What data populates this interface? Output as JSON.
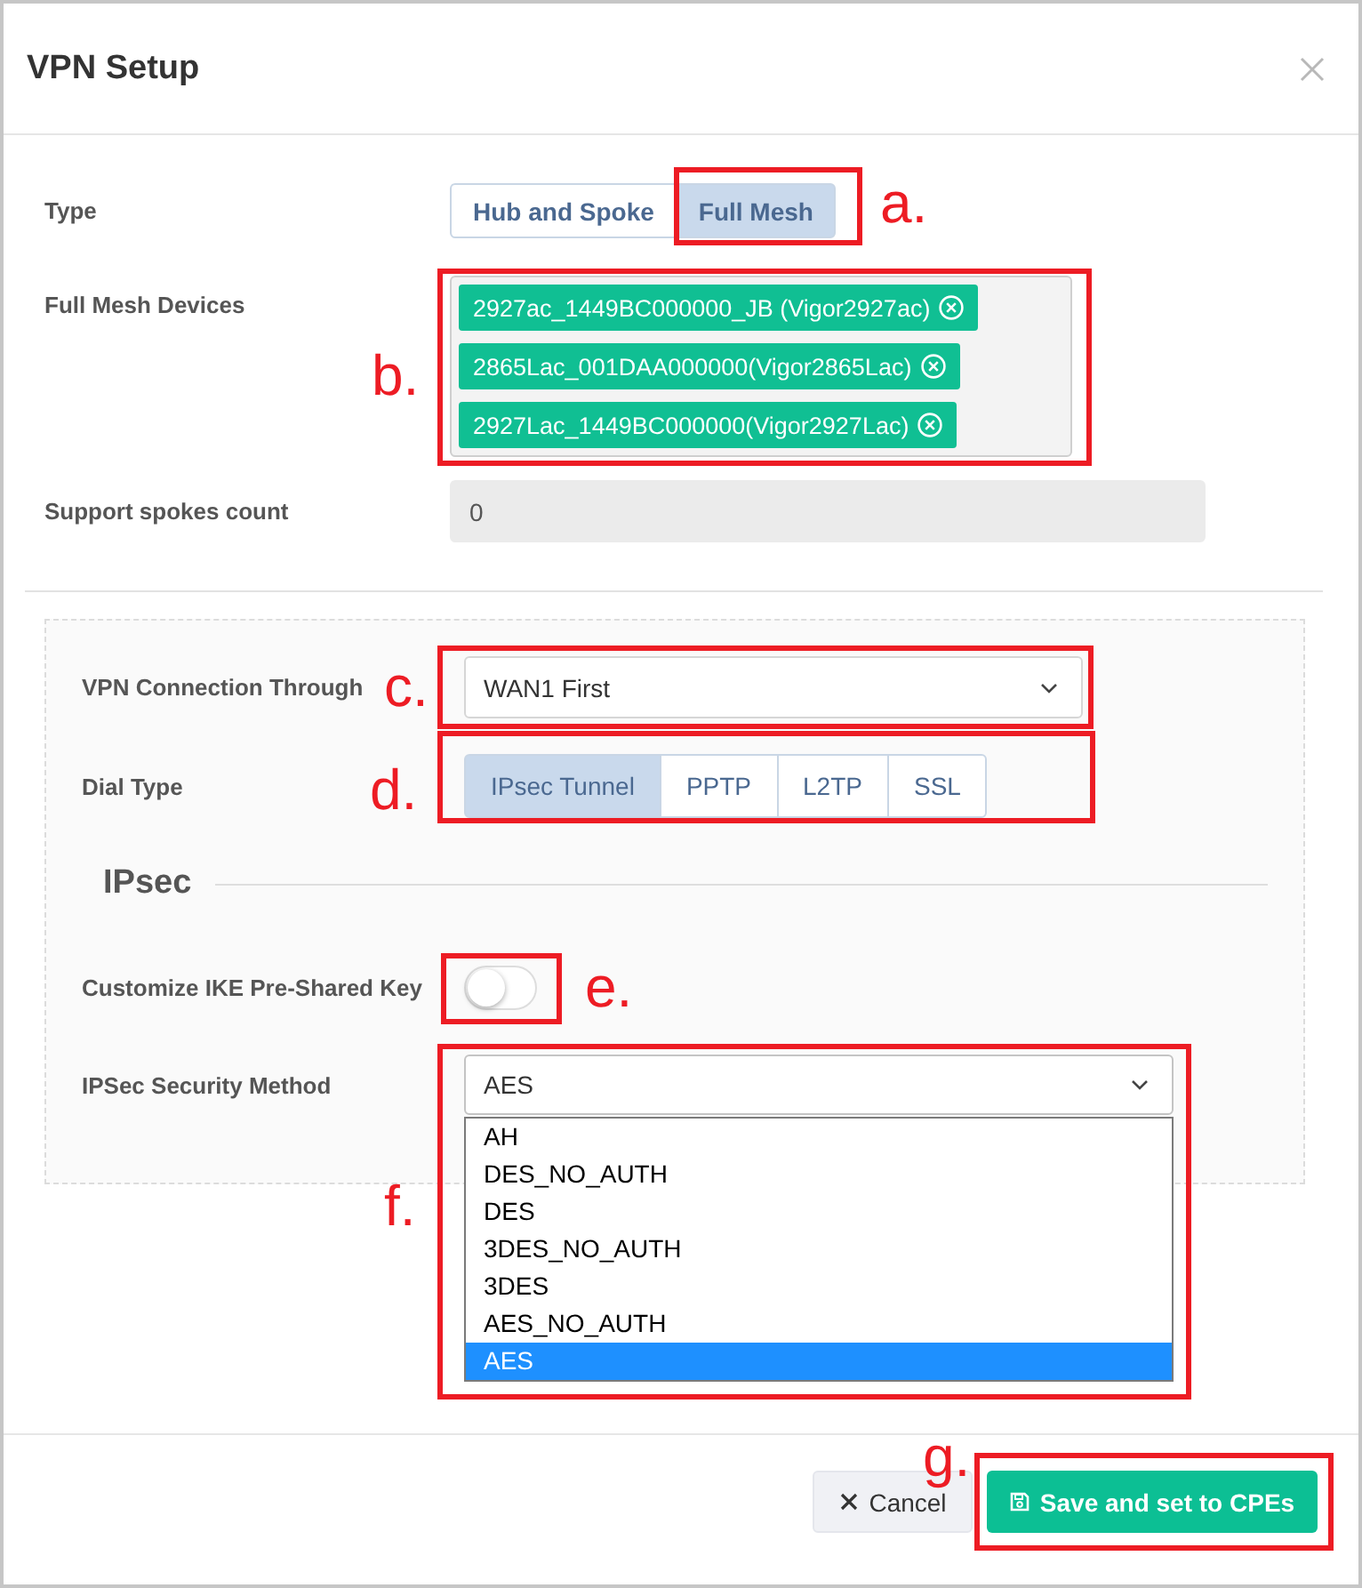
{
  "dialog": {
    "title": "VPN Setup"
  },
  "form": {
    "type": {
      "label": "Type",
      "options": [
        {
          "label": "Hub and Spoke",
          "selected": false
        },
        {
          "label": "Full Mesh",
          "selected": true
        }
      ]
    },
    "devices": {
      "label": "Full Mesh Devices",
      "tags": [
        "2927ac_1449BC000000_JB (Vigor2927ac)",
        "2865Lac_001DAA000000(Vigor2865Lac)",
        "2927Lac_1449BC000000(Vigor2927Lac)"
      ]
    },
    "spokes": {
      "label": "Support spokes count",
      "value": "0",
      "disabled": true
    }
  },
  "panel": {
    "connection": {
      "label": "VPN Connection Through",
      "value": "WAN1 First"
    },
    "dial_type": {
      "label": "Dial Type",
      "options": [
        {
          "label": "IPsec Tunnel",
          "selected": true
        },
        {
          "label": "PPTP",
          "selected": false
        },
        {
          "label": "L2TP",
          "selected": false
        },
        {
          "label": "SSL",
          "selected": false
        }
      ]
    },
    "section_title": "IPsec",
    "psk": {
      "label": "Customize IKE Pre-Shared Key",
      "on": false
    },
    "method": {
      "label": "IPSec Security Method",
      "value": "AES",
      "expanded": true,
      "options": [
        {
          "label": "AH",
          "selected": false
        },
        {
          "label": "DES_NO_AUTH",
          "selected": false
        },
        {
          "label": "DES",
          "selected": false
        },
        {
          "label": "3DES_NO_AUTH",
          "selected": false
        },
        {
          "label": "3DES",
          "selected": false
        },
        {
          "label": "AES_NO_AUTH",
          "selected": false
        },
        {
          "label": "AES",
          "selected": true
        }
      ]
    }
  },
  "footer": {
    "buttons": [
      {
        "kind": "cancel",
        "label": "Cancel"
      },
      {
        "kind": "save",
        "label": "Save and set to CPEs"
      }
    ]
  },
  "annotations": [
    {
      "label": "a."
    },
    {
      "label": "b."
    },
    {
      "label": "c."
    },
    {
      "label": "d."
    },
    {
      "label": "e."
    },
    {
      "label": "f."
    },
    {
      "label": "g."
    }
  ]
}
